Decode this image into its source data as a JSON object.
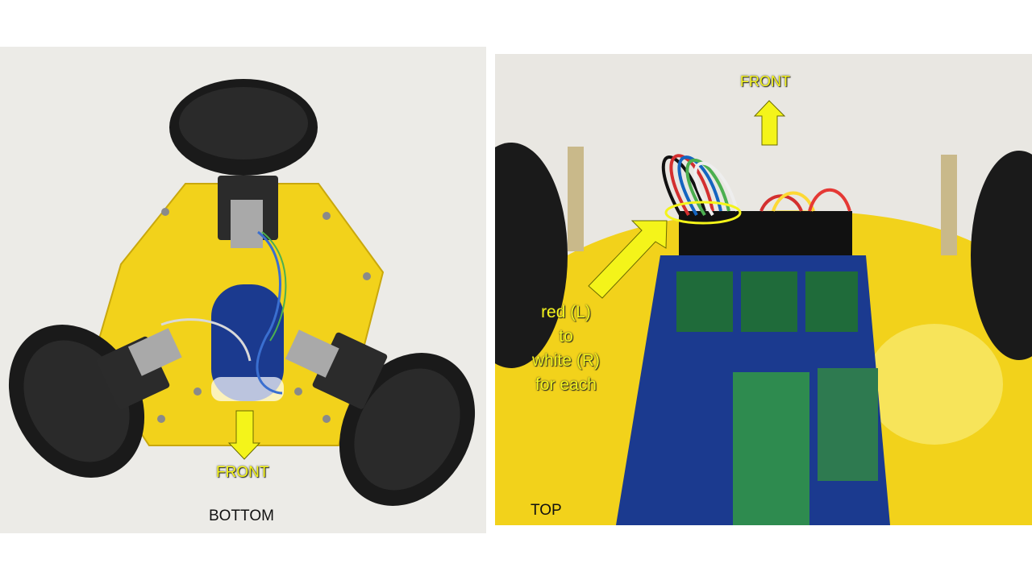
{
  "bottom_view": {
    "front_label": "FRONT",
    "caption": "BOTTOM"
  },
  "top_view": {
    "front_label": "FRONT",
    "caption": "TOP",
    "wiring_note": [
      "red (L)",
      "to",
      "white (R)",
      "for each"
    ]
  },
  "colors": {
    "annotation": "#f4f41a",
    "chassis": "#f2d21b",
    "pcb": "#1b3a8f",
    "wheel": "#1a1a1a"
  }
}
